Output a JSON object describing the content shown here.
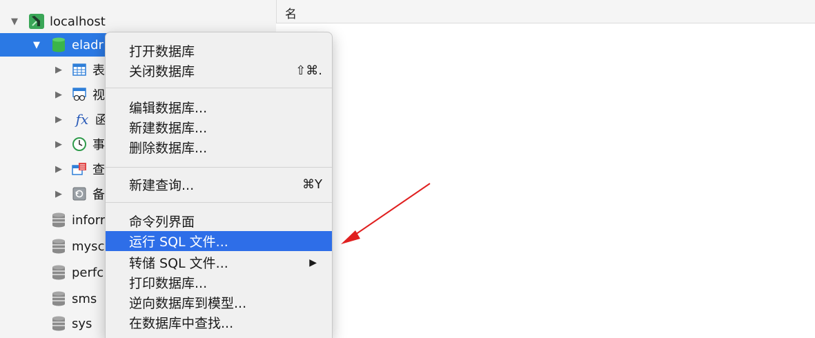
{
  "tree": {
    "connection": {
      "label": "localhost"
    },
    "database_selected": {
      "label": "eladr"
    },
    "groups": [
      {
        "label": "表"
      },
      {
        "label": "视"
      },
      {
        "label": "函"
      },
      {
        "label": "事"
      },
      {
        "label": "查"
      },
      {
        "label": "备"
      }
    ],
    "databases": [
      {
        "label": "inforr"
      },
      {
        "label": "mysc"
      },
      {
        "label": "perfc"
      },
      {
        "label": "sms"
      },
      {
        "label": "sys"
      }
    ],
    "function_glyph": "fx"
  },
  "content": {
    "header_name": "名"
  },
  "context_menu": {
    "items": [
      {
        "label": "打开数据库",
        "shortcut": ""
      },
      {
        "label": "关闭数据库",
        "shortcut": "⇧⌘."
      },
      {
        "label": "编辑数据库...",
        "shortcut": ""
      },
      {
        "label": "新建数据库...",
        "shortcut": ""
      },
      {
        "label": "删除数据库...",
        "shortcut": ""
      },
      {
        "label": "新建查询...",
        "shortcut": "⌘Y"
      },
      {
        "label": "命令列界面",
        "shortcut": ""
      },
      {
        "label": "运行 SQL 文件...",
        "shortcut": ""
      },
      {
        "label": "转储 SQL 文件...",
        "shortcut": "▶"
      },
      {
        "label": "打印数据库...",
        "shortcut": ""
      },
      {
        "label": "逆向数据库到模型...",
        "shortcut": ""
      },
      {
        "label": "在数据库中查找...",
        "shortcut": ""
      }
    ],
    "highlighted_index": 7
  },
  "colors": {
    "selection_blue": "#2b79e4",
    "menu_highlight": "#2e6ee8",
    "annotation_arrow": "#e02020",
    "db_green": "#3bb54a",
    "db_gray": "#8a8a8a"
  },
  "icons": {
    "connection": "navicat-connection-icon",
    "database": "database-cylinder-icon",
    "tables": "table-grid-icon",
    "views": "view-icon",
    "functions": "function-fx-icon",
    "events": "clock-event-icon",
    "queries": "query-icon",
    "backups": "backup-icon",
    "submenu": "chevron-right-icon"
  }
}
